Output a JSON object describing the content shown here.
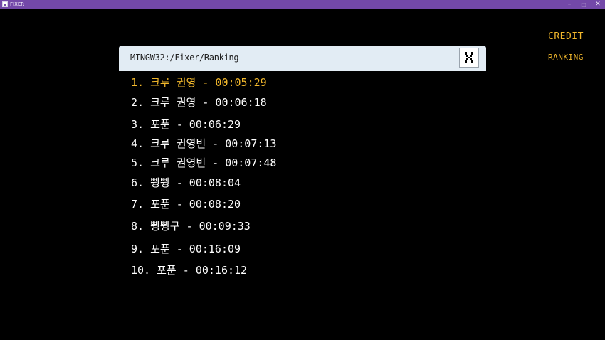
{
  "window": {
    "title": "FIXER",
    "minimize_glyph": "–",
    "maximize_glyph": "□",
    "close_glyph": "✕"
  },
  "menu": {
    "credit": "CREDIT",
    "ranking": "RANKING"
  },
  "panel": {
    "path": "MINGW32:/Fixer/Ranking",
    "close_icon": "x-icon"
  },
  "colors": {
    "titlebar": "#7348a8",
    "accent": "#f2b82c",
    "background": "#000000",
    "panel_header": "#e2ecf4",
    "text": "#ffffff"
  },
  "rankings": [
    {
      "text": "1. 크루 권영 - 00:05:29",
      "highlight": true
    },
    {
      "text": "2. 크루 권영 - 00:06:18",
      "highlight": false
    },
    {
      "text": "3. 포푼 - 00:06:29",
      "highlight": false
    },
    {
      "text": "4. 크루 권영빈 - 00:07:13",
      "highlight": false
    },
    {
      "text": "5. 크루 권영빈 - 00:07:48",
      "highlight": false
    },
    {
      "text": "6. 쀵쀵 - 00:08:04",
      "highlight": false
    },
    {
      "text": "7. 포푼 - 00:08:20",
      "highlight": false
    },
    {
      "text": "8. 쀵쀵구 - 00:09:33",
      "highlight": false
    },
    {
      "text": "9. 포푼 - 00:16:09",
      "highlight": false
    },
    {
      "text": "10. 포푼 - 00:16:12",
      "highlight": false
    }
  ]
}
